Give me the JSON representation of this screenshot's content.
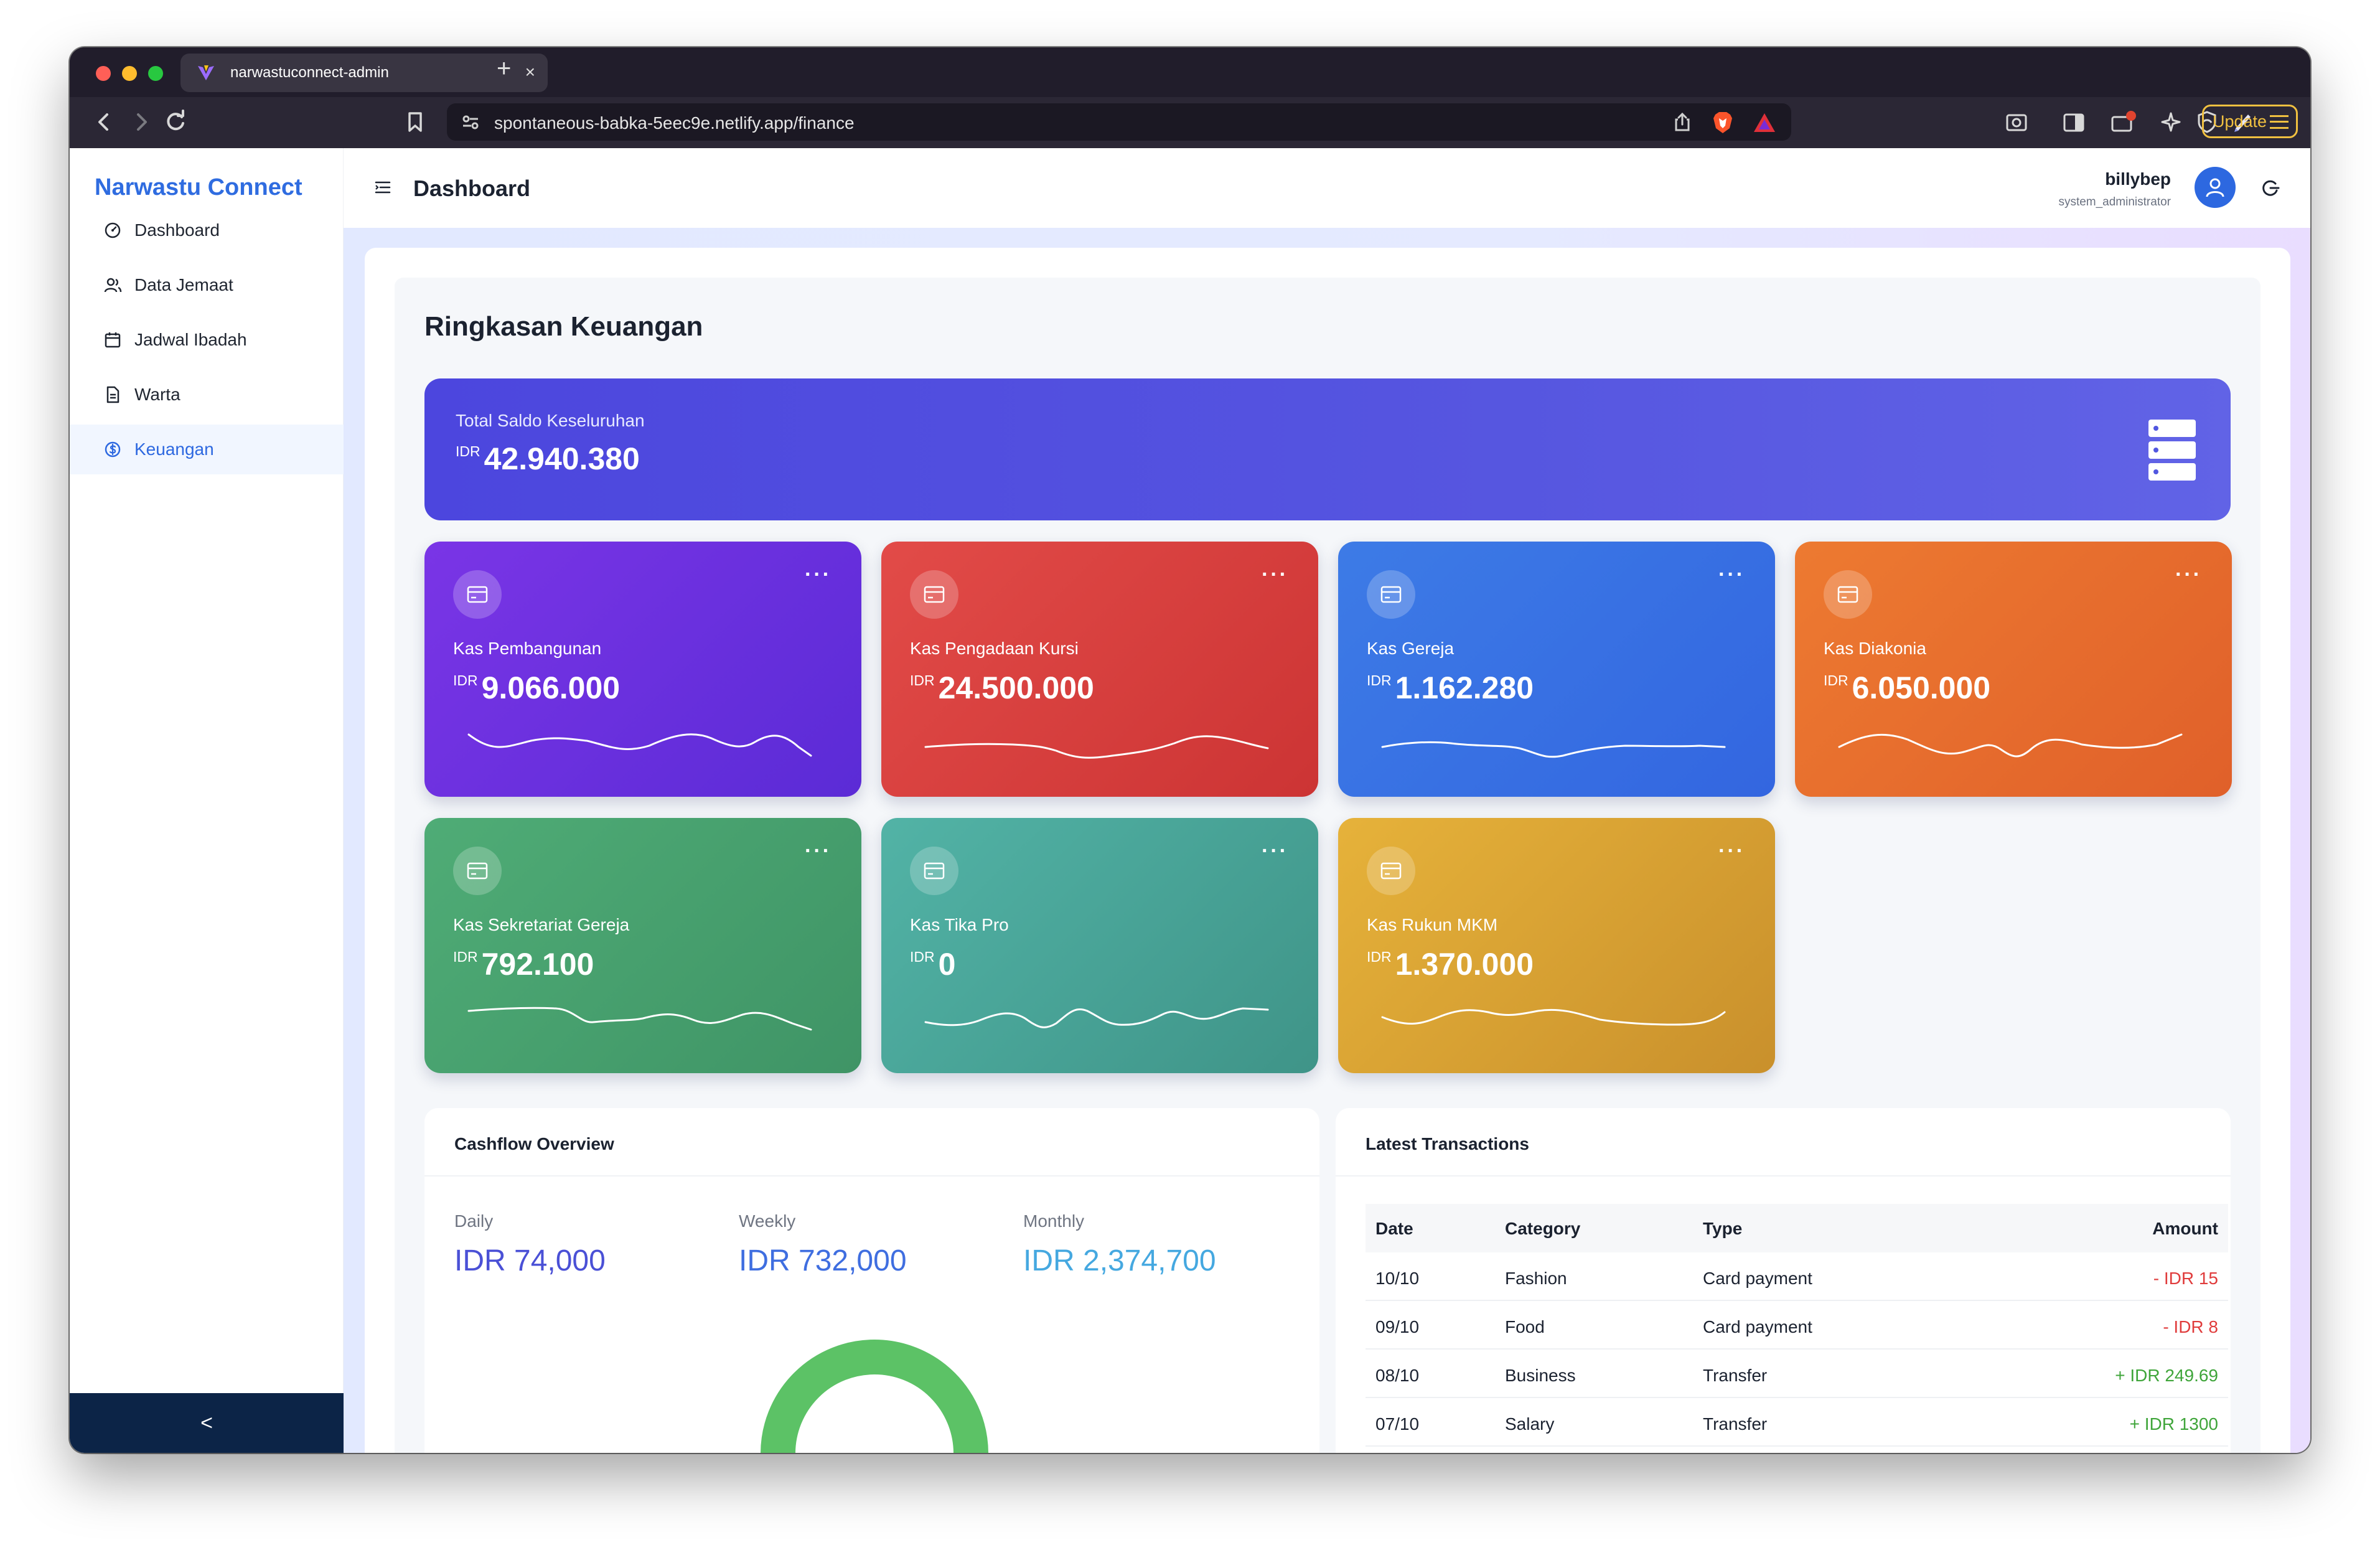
{
  "browser": {
    "tab_title": "narwastuconnect-admin",
    "tab_close": "×",
    "new_tab": "+",
    "url": "spontaneous-babka-5eec9e.netlify.app/finance",
    "update_label": "Update"
  },
  "sidebar": {
    "brand": "Narwastu Connect",
    "items": [
      {
        "label": "Dashboard",
        "icon": "dashboard-icon"
      },
      {
        "label": "Data Jemaat",
        "icon": "users-icon"
      },
      {
        "label": "Jadwal Ibadah",
        "icon": "calendar-icon"
      },
      {
        "label": "Warta",
        "icon": "document-icon"
      },
      {
        "label": "Keuangan",
        "icon": "dollar-circle-icon",
        "active": true
      }
    ],
    "collapse_label": "<"
  },
  "header": {
    "title": "Dashboard",
    "user_name": "billybep",
    "user_role": "system_administrator"
  },
  "finance": {
    "section_title": "Ringkasan Keuangan",
    "total": {
      "label": "Total Saldo Keseluruhan",
      "currency": "IDR",
      "amount": "42.940.380"
    },
    "more_label": "···",
    "funds": [
      {
        "name": "Kas Pembangunan",
        "currency": "IDR",
        "amount": "9.066.000",
        "color_start": "#7a35e6",
        "color_end": "#5b2bd6"
      },
      {
        "name": "Kas Pengadaan Kursi",
        "currency": "IDR",
        "amount": "24.500.000",
        "color_start": "#e24b48",
        "color_end": "#cc3434"
      },
      {
        "name": "Kas Gereja",
        "currency": "IDR",
        "amount": "1.162.280",
        "color_start": "#3d7be6",
        "color_end": "#3366e0"
      },
      {
        "name": "Kas Diakonia",
        "currency": "IDR",
        "amount": "6.050.000",
        "color_start": "#ed7a31",
        "color_end": "#e0602a"
      },
      {
        "name": "Kas Sekretariat Gereja",
        "currency": "IDR",
        "amount": "792.100",
        "color_start": "#4fac76",
        "color_end": "#3f9466"
      },
      {
        "name": "Kas Tika Pro",
        "currency": "IDR",
        "amount": "0",
        "color_start": "#52b3a6",
        "color_end": "#3f9488"
      },
      {
        "name": "Kas Rukun MKM",
        "currency": "IDR",
        "amount": "1.370.000",
        "color_start": "#e6b23a",
        "color_end": "#c9902c"
      }
    ]
  },
  "cashflow": {
    "title": "Cashflow Overview",
    "items": [
      {
        "label": "Daily",
        "value": "IDR 74,000",
        "color": "#4a50d6"
      },
      {
        "label": "Weekly",
        "value": "IDR 732,000",
        "color": "#3f6ee0"
      },
      {
        "label": "Monthly",
        "value": "IDR 2,374,700",
        "color": "#45a8e0"
      }
    ],
    "gauge_color": "#5cc266"
  },
  "transactions": {
    "title": "Latest Transactions",
    "columns": [
      "Date",
      "Category",
      "Type",
      "Amount"
    ],
    "rows": [
      {
        "date": "10/10",
        "category": "Fashion",
        "type": "Card payment",
        "amount": "- IDR 15",
        "sign": "neg"
      },
      {
        "date": "09/10",
        "category": "Food",
        "type": "Card payment",
        "amount": "- IDR 8",
        "sign": "neg"
      },
      {
        "date": "08/10",
        "category": "Business",
        "type": "Transfer",
        "amount": "+ IDR 249.69",
        "sign": "pos"
      },
      {
        "date": "07/10",
        "category": "Salary",
        "type": "Transfer",
        "amount": "+ IDR 1300",
        "sign": "pos"
      }
    ]
  }
}
